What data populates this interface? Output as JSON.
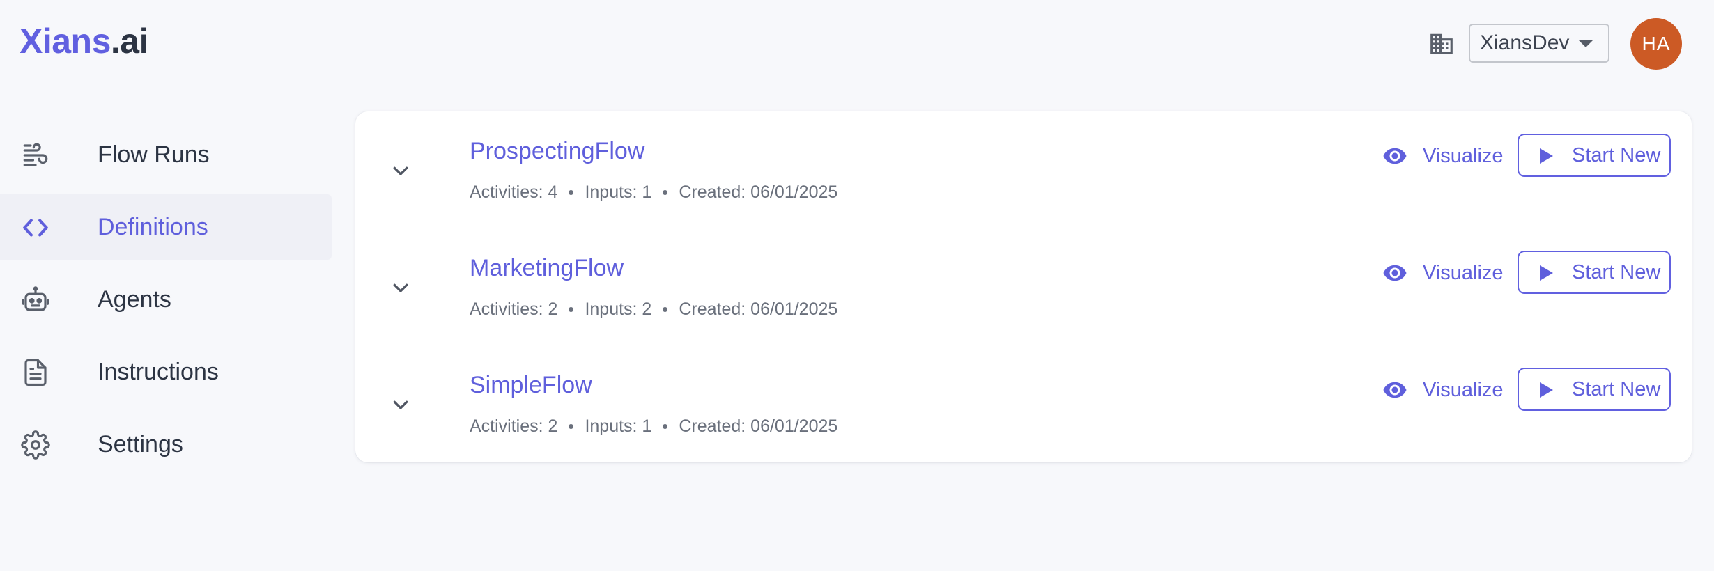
{
  "header": {
    "logo_brand": "Xians",
    "logo_tld": ".ai",
    "org_select_value": "XiansDev",
    "org_icon": "building-icon",
    "avatar_initials": "HA"
  },
  "sidebar": {
    "items": [
      {
        "label": "Flow Runs",
        "icon": "wind-icon",
        "active": false
      },
      {
        "label": "Definitions",
        "icon": "code-icon",
        "active": true
      },
      {
        "label": "Agents",
        "icon": "robot-icon",
        "active": false
      },
      {
        "label": "Instructions",
        "icon": "document-icon",
        "active": false
      },
      {
        "label": "Settings",
        "icon": "gear-icon",
        "active": false
      }
    ]
  },
  "flows": [
    {
      "name": "ProspectingFlow",
      "activities": "Activities: 4",
      "inputs": "Inputs: 1",
      "created": "Created: 06/01/2025"
    },
    {
      "name": "MarketingFlow",
      "activities": "Activities: 2",
      "inputs": "Inputs: 2",
      "created": "Created: 06/01/2025"
    },
    {
      "name": "SimpleFlow",
      "activities": "Activities: 2",
      "inputs": "Inputs: 1",
      "created": "Created: 06/01/2025"
    }
  ],
  "actions": {
    "visualize_label": "Visualize",
    "start_new_label": "Start New"
  },
  "colors": {
    "accent": "#6160e0",
    "avatar": "#cc5a25",
    "text": "#2c3443",
    "muted": "#6a707c"
  }
}
